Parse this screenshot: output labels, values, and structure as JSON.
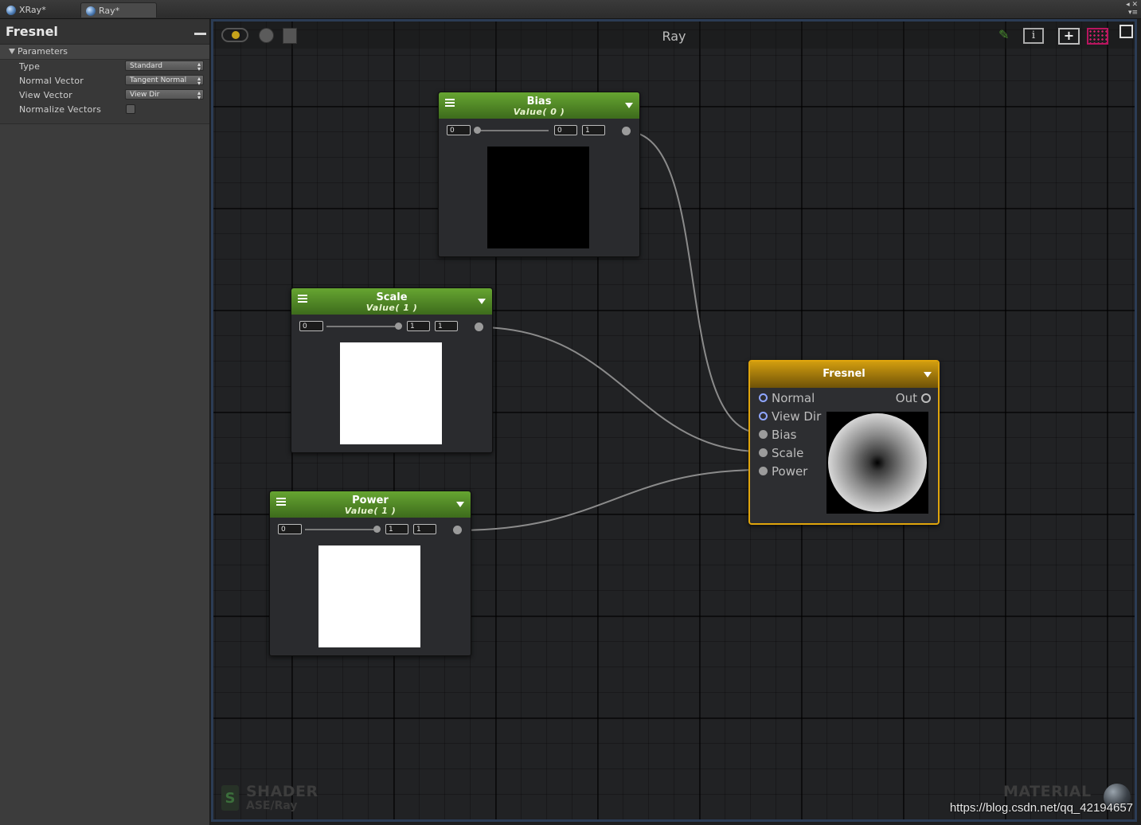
{
  "tabs": [
    {
      "label": "XRay*"
    },
    {
      "label": "Ray*"
    }
  ],
  "window_controls": {
    "top": "◂ ✕",
    "bottom": "▾≡"
  },
  "inspector": {
    "title": "Fresnel",
    "section_label": "Parameters",
    "rows": [
      {
        "label": "Type",
        "value": "Standard"
      },
      {
        "label": "Normal Vector",
        "value": "Tangent Normal"
      },
      {
        "label": "View Vector",
        "value": "View Dir"
      },
      {
        "label": "Normalize Vectors",
        "checked": false
      }
    ]
  },
  "graph": {
    "title": "Ray",
    "info_glyph": "i",
    "add_glyph": "+",
    "brush_glyph": "✎"
  },
  "nodes": {
    "bias": {
      "title": "Bias",
      "subtitle": "Value( 0 )",
      "min": "0",
      "value": "0",
      "max": "1",
      "preview": "#000000",
      "slider_fraction": 0
    },
    "scale": {
      "title": "Scale",
      "subtitle": "Value( 1 )",
      "min": "0",
      "value": "1",
      "max": "1",
      "preview": "#ffffff",
      "slider_fraction": 1
    },
    "power": {
      "title": "Power",
      "subtitle": "Value( 1 )",
      "min": "0",
      "value": "1",
      "max": "1",
      "preview": "#ffffff",
      "slider_fraction": 1
    },
    "fresnel": {
      "title": "Fresnel",
      "inputs": [
        "Normal",
        "View Dir",
        "Bias",
        "Scale",
        "Power"
      ],
      "output": "Out"
    }
  },
  "watermarks": {
    "shader_label": "SHADER",
    "shader_path": "ASE/Ray",
    "s_glyph": "S",
    "material_label": "MATERIAL",
    "url": "https://blog.csdn.net/qq_42194657"
  },
  "colors": {
    "green_header": "#5a9a2c",
    "fresnel_header": "#d19d0f",
    "fresnel_border": "#e0a50c",
    "canvas_border": "#2b3c55"
  }
}
